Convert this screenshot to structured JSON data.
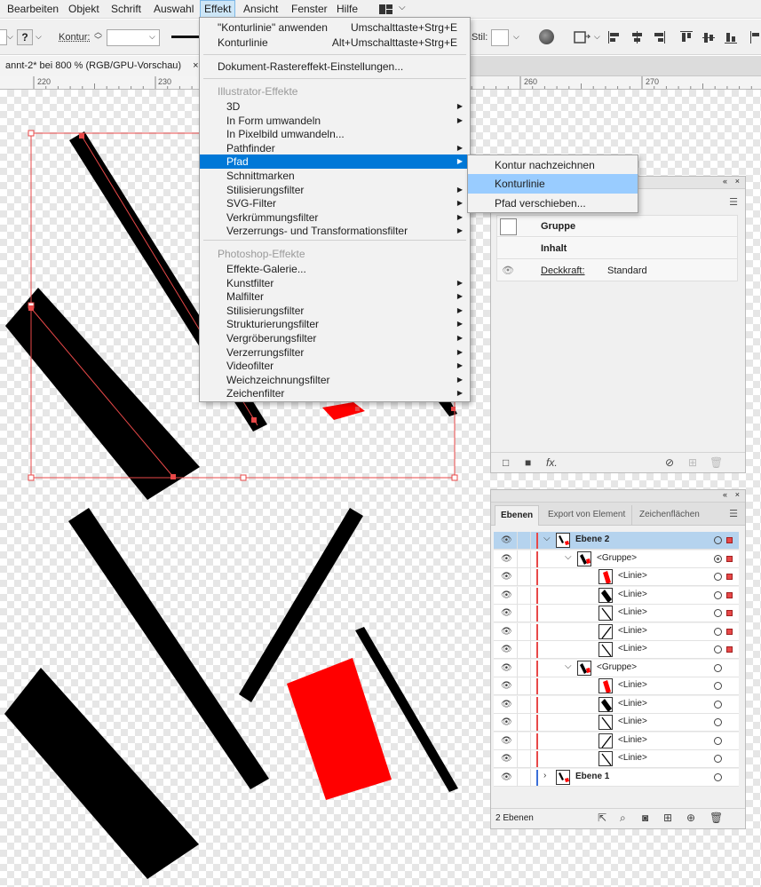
{
  "menubar": {
    "items": [
      "Bearbeiten",
      "Objekt",
      "Schrift",
      "Auswahl",
      "Effekt",
      "Ansicht",
      "Fenster",
      "Hilfe"
    ]
  },
  "controlbar": {
    "question_mark": "?",
    "kontur_label": "Kontur:",
    "stil_label": "Stil:"
  },
  "document_tab": {
    "title": "annt-2* bei 800 % (RGB/GPU-Vorschau)",
    "close": "×"
  },
  "ruler": {
    "labels": [
      "220",
      "230",
      "260",
      "270"
    ]
  },
  "effekt_menu": {
    "items": [
      {
        "label": "\"Konturlinie\" anwenden",
        "shortcut": "Umschalttaste+Strg+E"
      },
      {
        "label": "Konturlinie",
        "shortcut": "Alt+Umschalttaste+Strg+E"
      },
      {
        "label": "Dokument-Rastereffekt-Einstellungen..."
      }
    ],
    "illustrator_header": "Illustrator-Effekte",
    "illustrator_items": [
      {
        "label": "3D",
        "submenu": true
      },
      {
        "label": "In Form umwandeln",
        "submenu": true
      },
      {
        "label": "In Pixelbild umwandeln...",
        "submenu": false
      },
      {
        "label": "Pathfinder",
        "submenu": true
      },
      {
        "label": "Pfad",
        "submenu": true,
        "highlighted": true
      },
      {
        "label": "Schnittmarken",
        "submenu": false
      },
      {
        "label": "Stilisierungsfilter",
        "submenu": true
      },
      {
        "label": "SVG-Filter",
        "submenu": true
      },
      {
        "label": "Verkrümmungsfilter",
        "submenu": true
      },
      {
        "label": "Verzerrungs- und Transformationsfilter",
        "submenu": true
      }
    ],
    "photoshop_header": "Photoshop-Effekte",
    "photoshop_items": [
      {
        "label": "Effekte-Galerie...",
        "submenu": false
      },
      {
        "label": "Kunstfilter",
        "submenu": true
      },
      {
        "label": "Malfilter",
        "submenu": true
      },
      {
        "label": "Stilisierungsfilter",
        "submenu": true
      },
      {
        "label": "Strukturierungsfilter",
        "submenu": true
      },
      {
        "label": "Vergröberungsfilter",
        "submenu": true
      },
      {
        "label": "Verzerrungsfilter",
        "submenu": true
      },
      {
        "label": "Videofilter",
        "submenu": true
      },
      {
        "label": "Weichzeichnungsfilter",
        "submenu": true
      },
      {
        "label": "Zeichenfilter",
        "submenu": true
      }
    ]
  },
  "pfad_submenu": {
    "items": [
      {
        "label": "Kontur nachzeichnen"
      },
      {
        "label": "Konturlinie",
        "highlighted": true
      },
      {
        "label": "Pfad verschieben..."
      }
    ]
  },
  "appearance_panel": {
    "group_label": "Gruppe",
    "content_label": "Inhalt",
    "opacity_label": "Deckkraft:",
    "opacity_value": "Standard",
    "fx_label": "fx."
  },
  "layers_panel": {
    "tabs": [
      "Ebenen",
      "Export von Element",
      "Zeichenflächen"
    ],
    "rows": [
      {
        "name": "Ebene 2",
        "level": 0,
        "expanded": true,
        "selected": true,
        "color": "#e84848",
        "has_square": true
      },
      {
        "name": "<Gruppe>",
        "level": 1,
        "expanded": true,
        "selected": false,
        "color": "#e84848",
        "has_square": true
      },
      {
        "name": "<Linie>",
        "level": 2,
        "thumb": "red-bar",
        "color": "#e84848",
        "has_square": true
      },
      {
        "name": "<Linie>",
        "level": 2,
        "thumb": "black-bar",
        "color": "#e84848",
        "has_square": true
      },
      {
        "name": "<Linie>",
        "level": 2,
        "thumb": "line",
        "color": "#e84848",
        "has_square": true
      },
      {
        "name": "<Linie>",
        "level": 2,
        "thumb": "line2",
        "color": "#e84848",
        "has_square": true
      },
      {
        "name": "<Linie>",
        "level": 2,
        "thumb": "line",
        "color": "#e84848",
        "has_square": true
      },
      {
        "name": "<Gruppe>",
        "level": 1,
        "expanded": true,
        "selected": false,
        "color": "#e84848",
        "has_square": false
      },
      {
        "name": "<Linie>",
        "level": 2,
        "thumb": "red-bar",
        "color": "#e84848",
        "has_square": false
      },
      {
        "name": "<Linie>",
        "level": 2,
        "thumb": "black-bar",
        "color": "#e84848",
        "has_square": false
      },
      {
        "name": "<Linie>",
        "level": 2,
        "thumb": "line",
        "color": "#e84848",
        "has_square": false
      },
      {
        "name": "<Linie>",
        "level": 2,
        "thumb": "line2",
        "color": "#e84848",
        "has_square": false
      },
      {
        "name": "<Linie>",
        "level": 2,
        "thumb": "line",
        "color": "#e84848",
        "has_square": false
      },
      {
        "name": "Ebene 1",
        "level": 0,
        "expanded": false,
        "selected": false,
        "color": "#3a6fd8",
        "has_square": false
      }
    ],
    "footer_count": "2 Ebenen"
  },
  "colors": {
    "selection": "#e84848",
    "menu_highlight": "#0078d7",
    "submenu_highlight": "#99ccff",
    "art_red": "#ff0000",
    "art_black": "#000000"
  }
}
